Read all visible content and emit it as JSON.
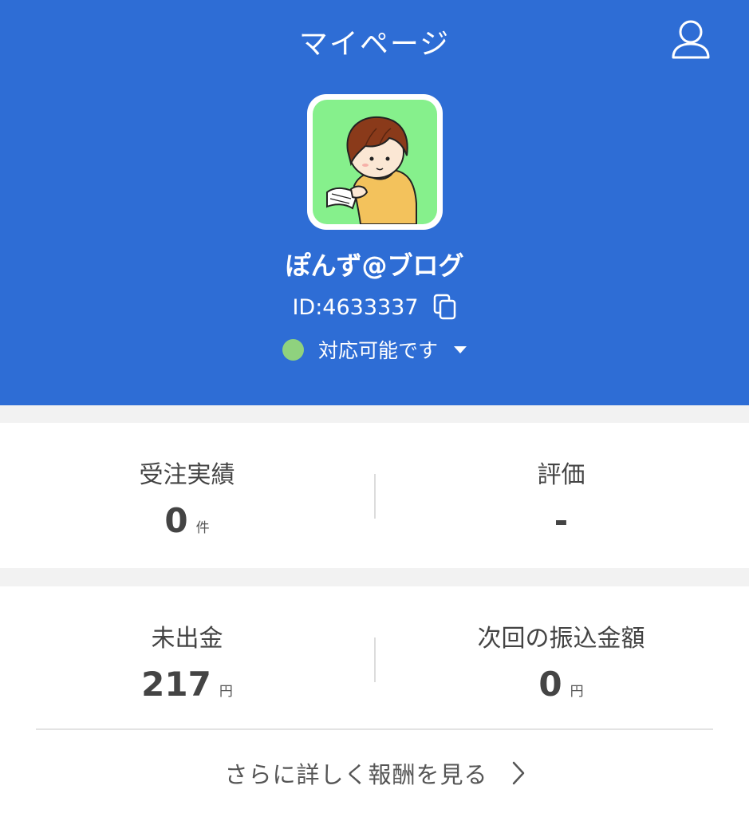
{
  "header": {
    "title": "マイページ",
    "user_icon": "user-icon"
  },
  "profile": {
    "avatar": "avatar-illustration",
    "name": "ぽんず@ブログ",
    "id_text": "ID:4633337",
    "copy_icon": "copy-icon",
    "status_text": "対応可能です",
    "status_color": "#8fd27e"
  },
  "stats": {
    "orders_label": "受注実績",
    "orders_value": "0",
    "orders_unit": "件",
    "rating_label": "評価",
    "rating_value": "-",
    "unpaid_label": "未出金",
    "unpaid_value": "217",
    "unpaid_unit": "円",
    "next_transfer_label": "次回の振込金額",
    "next_transfer_value": "0",
    "next_transfer_unit": "円"
  },
  "details_link": "さらに詳しく報酬を見る",
  "colors": {
    "header_bg": "#2e6dd5",
    "avatar_bg": "#86f08c"
  }
}
